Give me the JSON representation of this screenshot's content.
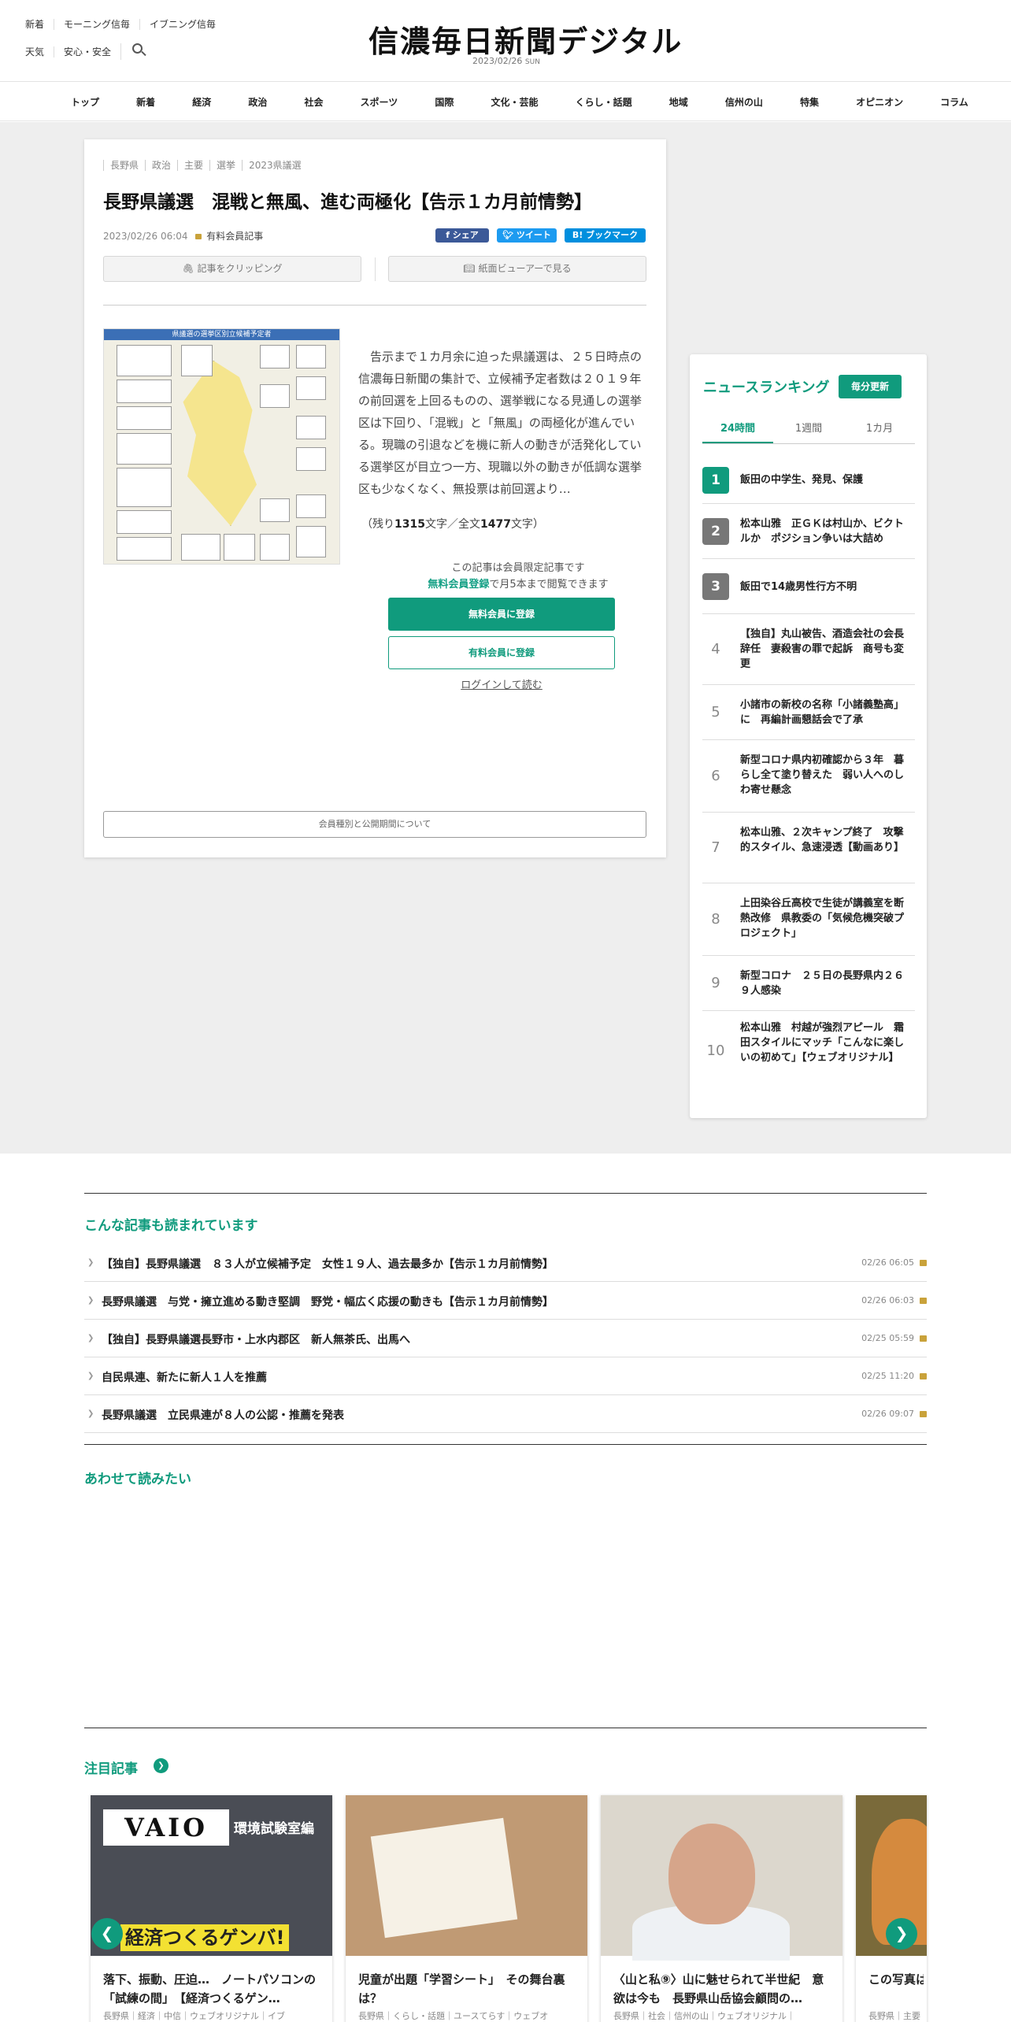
{
  "header": {
    "util_row1": [
      "新着",
      "モーニング信毎",
      "イブニング信毎"
    ],
    "util_row2": [
      "天気",
      "安心・安全"
    ],
    "logo": "信濃毎日新聞デジタル",
    "date": "2023/02/26",
    "dow": "SUN"
  },
  "nav": [
    "トップ",
    "新着",
    "経済",
    "政治",
    "社会",
    "スポーツ",
    "国際",
    "文化・芸能",
    "くらし・話題",
    "地域",
    "信州の山",
    "特集",
    "オピニオン",
    "コラム"
  ],
  "article": {
    "tags": [
      "長野県",
      "政治",
      "主要",
      "選挙",
      "2023県議選"
    ],
    "title": "長野県議選　混戦と無風、進む両極化【告示１カ月前情勢】",
    "datetime": "2023/02/26 06:04",
    "plan_label": "有料会員記事",
    "share_fb": "f シェア",
    "share_tw": "ツイート",
    "share_hb": "B! ブックマーク",
    "clip_btn": "記事をクリッピング",
    "viewer_btn": "紙面ビューアーで見る",
    "figure_caption": "県議選の選挙区別立候補予定者",
    "lead": "告示まで１カ月余に迫った県議選は、２５日時点の信濃毎日新聞の集計で、立候補予定者数は２０１９年の前回選を上回るものの、選挙戦になる見通しの選挙区は下回り、「混戦」と「無風」の両極化が進んでいる。現職の引退などを機に新人の動きが活発化している選挙区が目立つ一方、現職以外の動きが低調な選挙区も少なくなく、無投票は前回選より…",
    "remain_prefix": "（残り",
    "remain_count": "1315",
    "remain_mid": "文字／全文",
    "remain_total": "1477",
    "remain_suffix": "文字）",
    "members_note1": "この記事は会員限定記事です",
    "members_note2_link": "無料会員登録",
    "members_note2_rest": "で月5本まで閲覧できます",
    "btn_free": "無料会員に登録",
    "btn_paid": "有料会員に登録",
    "login": "ログインして読む",
    "btn_period": "会員種別と公開期間について"
  },
  "ranking": {
    "title": "ニュースランキング",
    "badge": "毎分更新",
    "tabs": [
      "24時間",
      "1週間",
      "1カ月"
    ],
    "items": [
      {
        "rank": "1",
        "text": "飯田の中学生、発見、保護"
      },
      {
        "rank": "2",
        "text": "松本山雅　正ＧＫは村山か、ビクトルか　ポジション争いは大詰め"
      },
      {
        "rank": "3",
        "text": "飯田で14歳男性行方不明"
      },
      {
        "rank": "4",
        "text": "【独自】丸山被告、酒造会社の会長辞任　妻殺害の罪で起訴　商号も変更"
      },
      {
        "rank": "5",
        "text": "小諸市の新校の名称「小諸義塾高」に　再編計画懇話会で了承"
      },
      {
        "rank": "6",
        "text": "新型コロナ県内初確認から３年　暮らし全て塗り替えた　弱い人へのしわ寄せ懸念"
      },
      {
        "rank": "7",
        "text": "松本山雅、２次キャンプ終了　攻撃的スタイル、急速浸透【動画あり】"
      },
      {
        "rank": "8",
        "text": "上田染谷丘高校で生徒が講義室を断熱改修　県教委の「気候危機突破プロジェクト」"
      },
      {
        "rank": "9",
        "text": "新型コロナ　２５日の長野県内２６９人感染"
      },
      {
        "rank": "10",
        "text": "松本山雅　村越が強烈アピール　霜田スタイルにマッチ「こんなに楽しいの初めて」【ウェブオリジナル】"
      }
    ]
  },
  "related": {
    "heading": "こんな記事も読まれています",
    "items": [
      {
        "title": "【独自】長野県議選　８３人が立候補予定　女性１９人、過去最多か【告示１カ月前情勢】",
        "date": "02/26 06:05"
      },
      {
        "title": "長野県議選　与党・擁立進める動き堅調　野党・幅広く応援の動きも【告示１カ月前情勢】",
        "date": "02/26 06:03"
      },
      {
        "title": "【独自】長野県議選長野市・上水内郡区　新人無茶氏、出馬へ",
        "date": "02/25 05:59"
      },
      {
        "title": "自民県連、新たに新人１人を推薦",
        "date": "02/25 11:20"
      },
      {
        "title": "長野県議選　立民県連が８人の公認・推薦を発表",
        "date": "02/26 09:07"
      }
    ]
  },
  "also_read": {
    "heading": "あわせて読みたい"
  },
  "featured": {
    "heading": "注目記事",
    "cards": [
      {
        "title": "落下、振動、圧迫…　ノートパソコンの「試練の間」　【経済つくるゲン…",
        "tags": "長野県｜経済｜中信｜ウェブオリジナル｜イブ",
        "logo": "VAIO",
        "sub": "環境試験室編",
        "banner": "経済つくるゲンバ!"
      },
      {
        "title": "児童が出題「学習シート」　その舞台裏は？",
        "tags": "長野県｜くらし・話題｜ユースてらす｜ウェブオ"
      },
      {
        "title": "〈山と私⑨〉山に魅せられて半世紀　意欲は今も　長野県山岳協会顧問の…",
        "tags": "長野県｜社会｜信州の山｜ウェブオリジナル｜"
      },
      {
        "title": "この写真は…日のこと聴…",
        "tags": "長野県｜主要"
      }
    ]
  }
}
